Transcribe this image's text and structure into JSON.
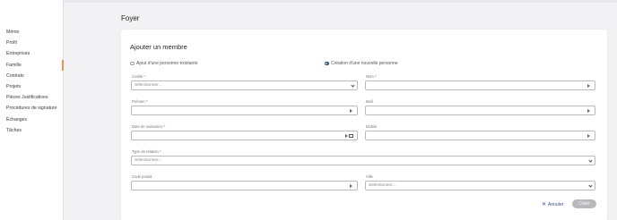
{
  "sidebar": {
    "items": [
      {
        "label": "Mémo"
      },
      {
        "label": "Profil"
      },
      {
        "label": "Entreprises"
      },
      {
        "label": "Famille"
      },
      {
        "label": "Contrats"
      },
      {
        "label": "Projets"
      },
      {
        "label": "Pièces Justificatives"
      },
      {
        "label": "Procédures de signature"
      },
      {
        "label": "Échanges"
      },
      {
        "label": "Tâches"
      }
    ],
    "active": "Famille"
  },
  "page": {
    "title": "Foyer"
  },
  "form": {
    "title": "Ajouter un membre",
    "radio_existing": "Ajout d'une personne existante",
    "radio_new": "Création d'une nouvelle personne",
    "selected_option": "Création d'une nouvelle personne",
    "civilite": {
      "label": "Civilité *",
      "value": "Sélectionner..."
    },
    "nom": {
      "label": "Nom *",
      "value": ""
    },
    "prenom": {
      "label": "Prénom *",
      "value": ""
    },
    "mail": {
      "label": "Mail",
      "value": ""
    },
    "date_naissance": {
      "label": "Date de naissance *",
      "value": ""
    },
    "mobile": {
      "label": "Mobile",
      "value": ""
    },
    "type_relation": {
      "label": "Type de relation *",
      "value": "Sélectionner..."
    },
    "code_postal": {
      "label": "Code postal",
      "value": ""
    },
    "ville": {
      "label": "Ville",
      "value": "Sélectionner..."
    },
    "cancel_label": "Annuler",
    "create_label": "Créer"
  },
  "colors": {
    "accent": "#3b4b8a",
    "active_marker": "#f0924f",
    "disabled_button": "#b9b9bd"
  }
}
